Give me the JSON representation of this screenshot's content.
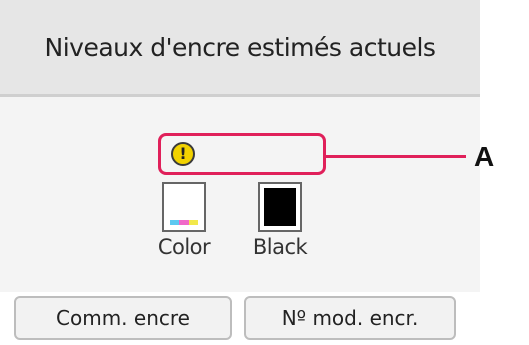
{
  "header": {
    "title": "Niveaux d'encre estimés actuels"
  },
  "ink": {
    "warning_icon": "exclamation-warning-icon",
    "callout_label": "A",
    "cartridges": [
      {
        "label": "Color",
        "icon": "color-cartridge-icon"
      },
      {
        "label": "Black",
        "icon": "black-cartridge-icon"
      }
    ]
  },
  "buttons": {
    "order_ink": "Comm. encre",
    "ink_model_number": "Nº mod. encr."
  },
  "colors": {
    "highlight": "#e0205a",
    "warning": "#f2d200",
    "cyan": "#5ec8f0",
    "magenta": "#f06ac8",
    "yellow": "#f2e84a"
  }
}
